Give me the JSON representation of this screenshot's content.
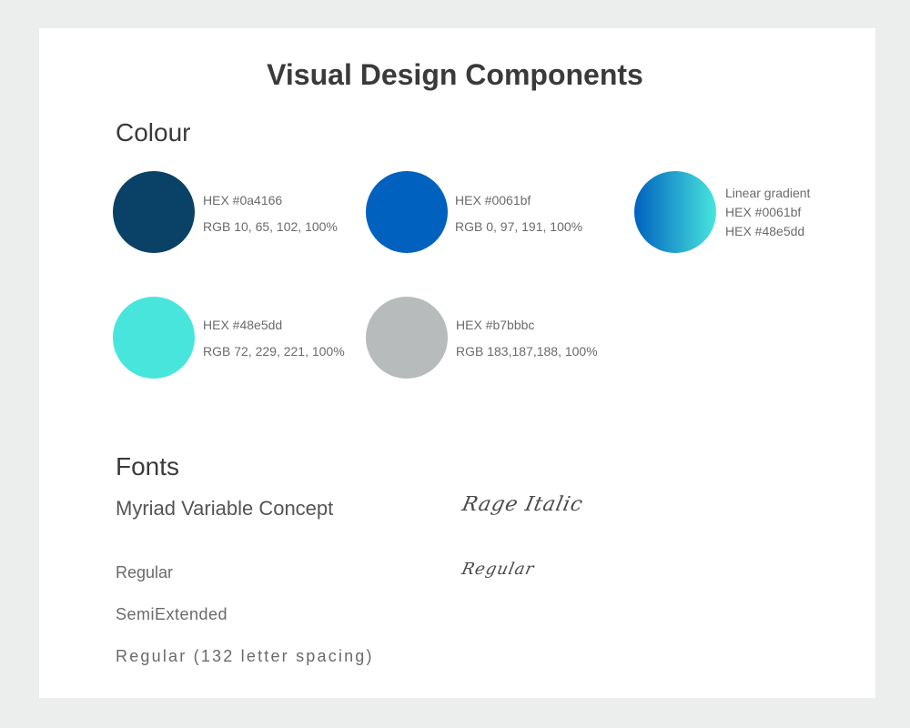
{
  "title": "Visual Design Components",
  "colour_section": {
    "heading": "Colour",
    "swatches": [
      {
        "kind": "solid",
        "fill": "#0a4166",
        "lines": [
          "HEX #0a4166",
          "RGB 10, 65, 102, 100%"
        ]
      },
      {
        "kind": "solid",
        "fill": "#0061bf",
        "lines": [
          "HEX #0061bf",
          "RGB 0, 97, 191, 100%"
        ]
      },
      {
        "kind": "gradient",
        "gradient_from": "#0061bf",
        "gradient_to": "#48e5dd",
        "lines": [
          "Linear gradient",
          "HEX #0061bf",
          "HEX #48e5dd"
        ]
      },
      {
        "kind": "solid",
        "fill": "#48e5dd",
        "lines": [
          "HEX #48e5dd",
          "RGB 72, 229, 221, 100%"
        ]
      },
      {
        "kind": "solid",
        "fill": "#b7bbbc",
        "lines": [
          "HEX #b7bbbc",
          "RGB 183,187,188, 100%"
        ]
      }
    ]
  },
  "fonts_section": {
    "heading": "Fonts",
    "primary_font": {
      "name": "Myriad Variable Concept",
      "styles": [
        "Regular",
        "SemiExtended",
        "Regular (132 letter spacing)"
      ]
    },
    "script_font": {
      "name": "Rage Italic",
      "styles": [
        "Regular"
      ]
    }
  },
  "colors": {
    "background": "#eceeed",
    "card": "#ffffff",
    "heading_text": "#3a3a3a",
    "body_text": "#6b6b6b"
  }
}
